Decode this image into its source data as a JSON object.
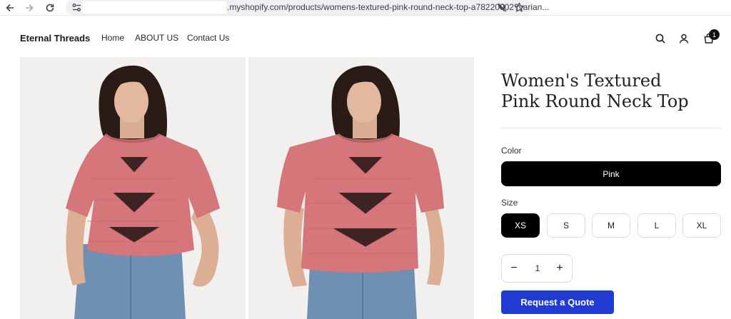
{
  "browser": {
    "url_text": ".myshopify.com/products/womens-textured-pink-round-neck-top-a78220002?varian...",
    "icons": [
      "back-arrow-icon",
      "forward-arrow-icon",
      "reload-icon",
      "site-settings-icon",
      "tracking-blocked-icon",
      "bookmark-star-icon"
    ]
  },
  "header": {
    "brand": "Eternal Threads",
    "nav": [
      "Home",
      "ABOUT US",
      "Contact Us"
    ],
    "cart_count": "1",
    "icons": [
      "search-icon",
      "account-icon",
      "cart-icon"
    ]
  },
  "product": {
    "title_line1": "Women's Textured",
    "title_line2": "Pink Round Neck Top",
    "color_label": "Color",
    "color_value": "Pink",
    "size_label": "Size",
    "sizes": [
      "XS",
      "S",
      "M",
      "L",
      "XL"
    ],
    "selected_size": "XS",
    "quantity": "1",
    "qty_minus": "−",
    "qty_plus": "+",
    "cta": "Request a Quote"
  },
  "colors": {
    "accent": "#1f3bd1",
    "selected_bg": "#000000",
    "shirt": "#d4767a",
    "jeans": "#6f8fb3"
  }
}
